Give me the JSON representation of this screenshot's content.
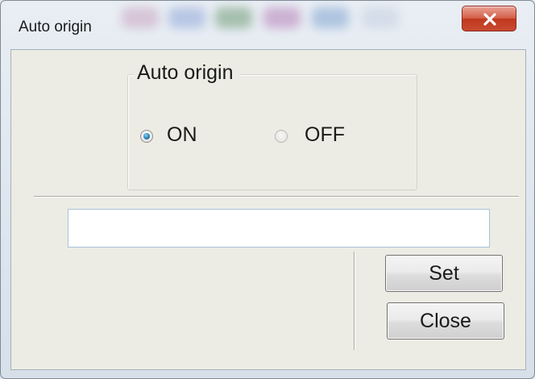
{
  "window": {
    "title": "Auto origin",
    "close_icon": "close-icon"
  },
  "group": {
    "legend": "Auto origin",
    "options": [
      {
        "label": "ON",
        "checked": true
      },
      {
        "label": "OFF",
        "checked": false
      }
    ]
  },
  "input": {
    "value": ""
  },
  "buttons": {
    "set_label": "Set",
    "close_label": "Close"
  },
  "colors": {
    "close_button": "#c8432a",
    "radio_selected": "#2a7fb6"
  }
}
